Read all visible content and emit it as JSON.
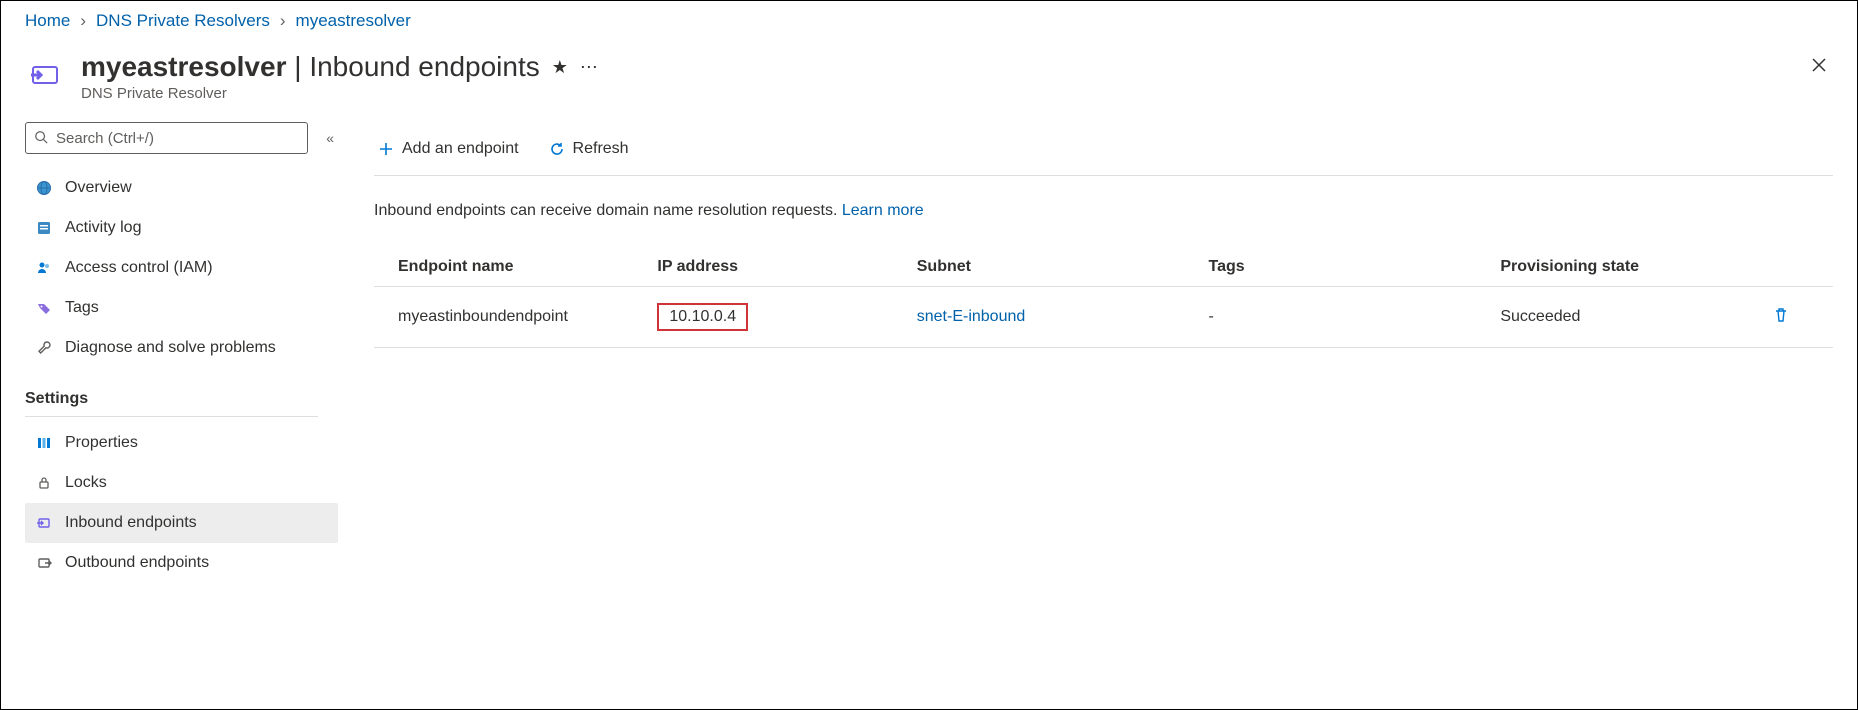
{
  "breadcrumb": [
    {
      "label": "Home"
    },
    {
      "label": "DNS Private Resolvers"
    },
    {
      "label": "myeastresolver"
    }
  ],
  "header": {
    "title_bold": "myeastresolver",
    "title_suffix": " | Inbound endpoints",
    "subtitle": "DNS Private Resolver"
  },
  "sidebar": {
    "search_placeholder": "Search (Ctrl+/)",
    "items_top": [
      {
        "label": "Overview",
        "key": "overview"
      },
      {
        "label": "Activity log",
        "key": "activity-log"
      },
      {
        "label": "Access control (IAM)",
        "key": "access-control"
      },
      {
        "label": "Tags",
        "key": "tags"
      },
      {
        "label": "Diagnose and solve problems",
        "key": "diagnose"
      }
    ],
    "section_header": "Settings",
    "items_settings": [
      {
        "label": "Properties",
        "key": "properties"
      },
      {
        "label": "Locks",
        "key": "locks"
      },
      {
        "label": "Inbound endpoints",
        "key": "inbound-endpoints",
        "selected": true
      },
      {
        "label": "Outbound endpoints",
        "key": "outbound-endpoints"
      }
    ]
  },
  "toolbar": {
    "add": "Add an endpoint",
    "refresh": "Refresh"
  },
  "info": {
    "text": "Inbound endpoints can receive domain name resolution requests. ",
    "link": "Learn more"
  },
  "table": {
    "columns": [
      "Endpoint name",
      "IP address",
      "Subnet",
      "Tags",
      "Provisioning state"
    ],
    "rows": [
      {
        "name": "myeastinboundendpoint",
        "ip": "10.10.0.4",
        "ip_highlight": true,
        "subnet": "snet-E-inbound",
        "tags": "-",
        "state": "Succeeded"
      }
    ]
  }
}
